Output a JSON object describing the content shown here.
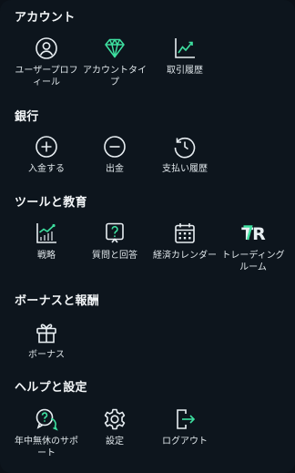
{
  "sections": {
    "account": {
      "title": "アカウント",
      "items": [
        "ユーザープロフィール",
        "アカウントタイプ",
        "取引履歴"
      ]
    },
    "bank": {
      "title": "銀行",
      "items": [
        "入金する",
        "出金",
        "支払い履歴"
      ]
    },
    "tools": {
      "title": "ツールと教育",
      "items": [
        "戦略",
        "質問と回答",
        "経済カレンダー",
        "トレーディングルーム"
      ],
      "tr_logo_text": "TR"
    },
    "bonus": {
      "title": "ボーナスと報酬",
      "items": [
        "ボーナス"
      ]
    },
    "help": {
      "title": "ヘルプと設定",
      "items": [
        "年中無休のサポート",
        "設定",
        "ログアウト"
      ]
    }
  },
  "colors": {
    "accent": "#3ee0a0",
    "icon": "#e8eef2",
    "background": "#0d151d"
  }
}
